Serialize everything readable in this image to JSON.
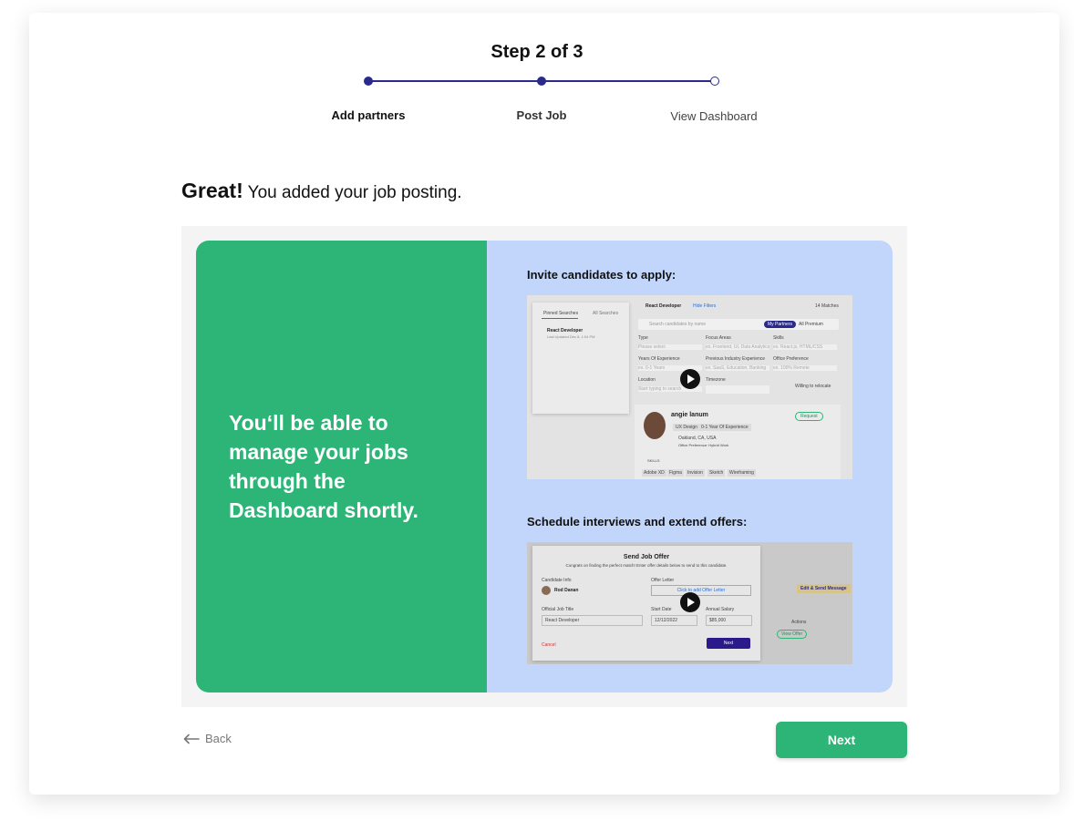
{
  "stepper": {
    "title": "Step 2 of 3",
    "steps": [
      {
        "label": "Add partners",
        "state": "done"
      },
      {
        "label": "Post Job",
        "state": "current"
      },
      {
        "label": "View Dashboard",
        "state": "upcoming"
      }
    ],
    "accent": "#2a2a8c"
  },
  "heading": {
    "strong": "Great!",
    "rest": " You added your job posting."
  },
  "promo": {
    "message": "You‘ll be able to manage your jobs through the Dashboard shortly.",
    "green": "#2db577",
    "blue": "#c2d6fb"
  },
  "video1": {
    "title": "Invite candidates to apply:",
    "preview": {
      "tab_pinned": "Pinned Searches",
      "tab_all": "All Searches",
      "saved_search": "React Developer",
      "saved_search_sub": "Last Updated Dec 8, 1:04 PM",
      "job_title": "React Developer",
      "hide_filters": "Hide Filters",
      "matches": "14 Matches",
      "search_placeholder": "Search candidates by name",
      "my_partners": "My Partners",
      "all_premium": "All Premium",
      "f_type": "Type",
      "f_type_ph": "Please select",
      "f_focus": "Focus Areas",
      "f_focus_ph": "ex. Frontend, UI, Data Analytics",
      "f_skills": "Skills",
      "f_skills_ph": "ex. React.js, HTML/CSS",
      "f_years": "Years Of Experience",
      "f_years_ph": "ex. 0-1 Years",
      "f_industry": "Previous Industry Experience",
      "f_industry_ph": "ex. SaaS, Education, Banking",
      "f_office": "Office Preference",
      "f_office_ph": "ex. 100% Remote",
      "f_location": "Location",
      "f_location_ph": "Start typing to search",
      "f_timezone": "Timezone",
      "relocate": "Willing to relocate",
      "cand_name": "angie lanum",
      "tag1": "UX Design",
      "tag2": "0-1 Year Of Experience",
      "request": "Request",
      "location": "Oakland, CA, USA",
      "office_pref": "Office Preference: Hybrid Work",
      "skills_label": "SKILLS",
      "skills": [
        "Adobe XD",
        "Figma",
        "Invision",
        "Sketch",
        "Wireframing"
      ]
    }
  },
  "video2": {
    "title": "Schedule interviews and extend offers:",
    "preview": {
      "modal_title": "Send Job Offer",
      "modal_sub": "Congrats on finding the perfect match! Enter offer details below to send to this candidate.",
      "candidate_info": "Candidate Info",
      "candidate_name": "Rod Danan",
      "offer_letter": "Offer Letter",
      "offer_link": "Click to add Offer Letter",
      "official_title": "Official Job Title",
      "official_title_val": "React Developer",
      "start_date": "Start Date",
      "start_date_val": "12/12/2022",
      "salary": "Annual Salary",
      "salary_val": "$85,000",
      "cancel": "Cancel",
      "next": "Next",
      "edit_send": "Edit & Send Message",
      "actions": "Actions",
      "view_offer": "View Offer"
    }
  },
  "footer": {
    "back": "Back",
    "next": "Next"
  }
}
